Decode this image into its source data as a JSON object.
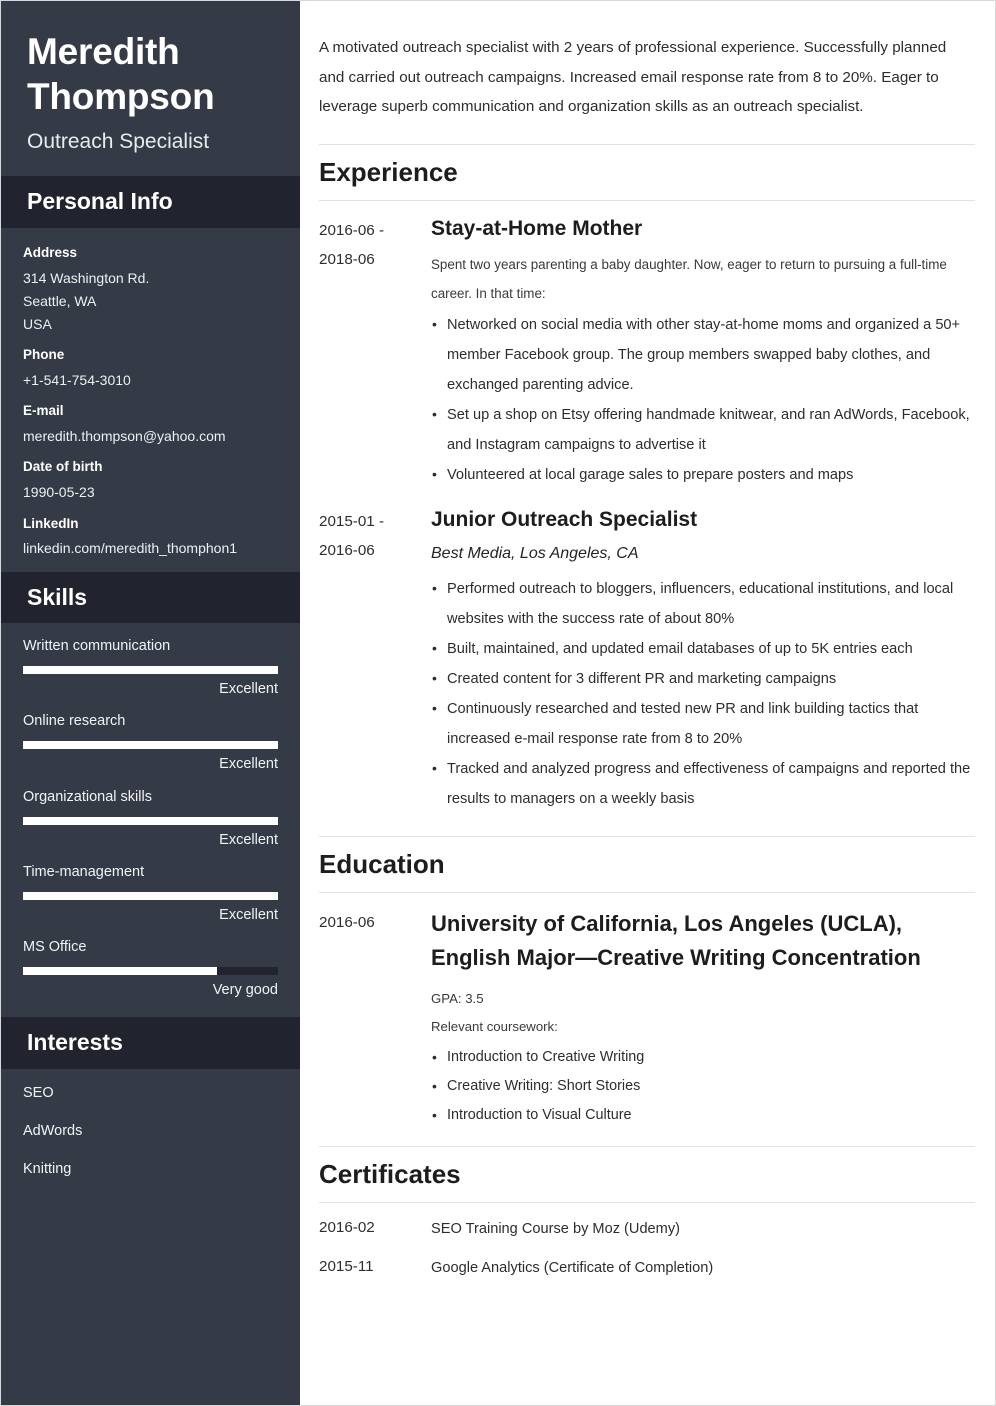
{
  "theme": {
    "sidebar_bg": "#343a46",
    "sidebar_header_bg": "#21242e",
    "text_light": "#ffffff",
    "main_text": "#2d2d2d",
    "rule": "#e2e2e2"
  },
  "sidebar": {
    "full_name": "Meredith Thompson",
    "job_title": "Outreach Specialist",
    "personal_info": {
      "heading": "Personal Info",
      "groups": [
        {
          "label": "Address",
          "values": [
            "314 Washington Rd.",
            "Seattle, WA",
            "USA"
          ]
        },
        {
          "label": "Phone",
          "values": [
            "+1-541-754-3010"
          ]
        },
        {
          "label": "E-mail",
          "values": [
            "meredith.thompson@yahoo.com"
          ]
        },
        {
          "label": "Date of birth",
          "values": [
            "1990-05-23"
          ]
        },
        {
          "label": "LinkedIn",
          "values": [
            "linkedin.com/meredith_thomphon1"
          ]
        }
      ]
    },
    "skills": {
      "heading": "Skills",
      "items": [
        {
          "name": "Written communication",
          "level": "Excellent",
          "percent": 100
        },
        {
          "name": "Online research",
          "level": "Excellent",
          "percent": 100
        },
        {
          "name": "Organizational skills",
          "level": "Excellent",
          "percent": 100
        },
        {
          "name": "Time-management",
          "level": "Excellent",
          "percent": 100
        },
        {
          "name": "MS Office",
          "level": "Very good",
          "percent": 76
        }
      ]
    },
    "interests": {
      "heading": "Interests",
      "items": [
        "SEO",
        "AdWords",
        "Knitting"
      ]
    }
  },
  "main": {
    "summary": "A motivated outreach specialist with 2 years of professional experience. Successfully planned and carried out outreach campaigns. Increased email response rate from 8 to 20%. Eager to leverage superb communication and organization skills as an outreach specialist.",
    "experience": {
      "heading": "Experience",
      "entries": [
        {
          "date_start": "2016-06 -",
          "date_end": "2018-06",
          "title": "Stay-at-Home Mother",
          "company": "",
          "description": "Spent two years parenting a baby daughter. Now, eager to return to pursuing a full-time career. In that time:",
          "bullets": [
            "Networked on social media with other stay-at-home moms and organized a 50+ member Facebook group. The group members swapped baby clothes, and exchanged parenting advice.",
            "Set up a shop on Etsy offering handmade knitwear, and ran AdWords, Facebook, and Instagram campaigns to advertise it",
            "Volunteered at local garage sales to prepare posters and maps"
          ]
        },
        {
          "date_start": "2015-01 -",
          "date_end": "2016-06",
          "title": "Junior Outreach Specialist",
          "company": "Best Media, Los Angeles, CA",
          "description": "",
          "bullets": [
            "Performed outreach to bloggers, influencers, educational institutions, and local websites with the success rate of about 80%",
            "Built, maintained, and updated email databases of up to 5K entries each",
            "Created content for 3 different PR and marketing campaigns",
            "Continuously researched and tested new PR and link building tactics that increased e-mail response rate from 8 to 20%",
            "Tracked and analyzed progress and effectiveness of campaigns and reported the results to managers on a weekly basis"
          ]
        }
      ]
    },
    "education": {
      "heading": "Education",
      "entries": [
        {
          "date": "2016-06",
          "title": "University of California, Los Angeles (UCLA), English Major—Creative Writing Concentration",
          "gpa": "GPA: 3.5",
          "coursework_label": "Relevant coursework:",
          "coursework": [
            "Introduction to Creative Writing",
            "Creative Writing: Short Stories",
            "Introduction to Visual Culture"
          ]
        }
      ]
    },
    "certificates": {
      "heading": "Certificates",
      "entries": [
        {
          "date": "2016-02",
          "name": "SEO Training Course by Moz (Udemy)"
        },
        {
          "date": "2015-11",
          "name": "Google Analytics (Certificate of Completion)"
        }
      ]
    }
  }
}
